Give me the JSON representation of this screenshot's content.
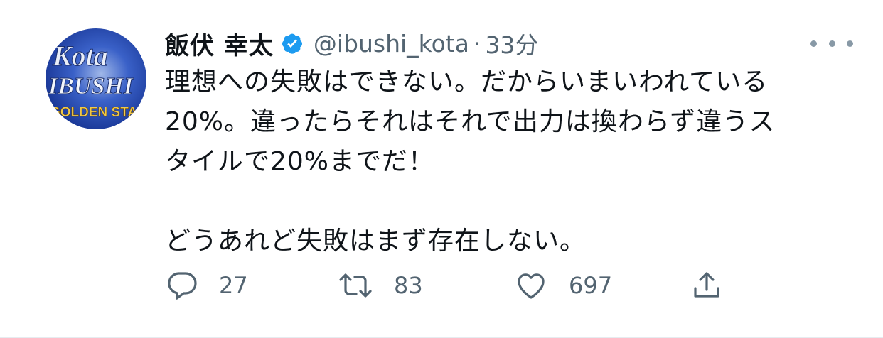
{
  "tweet": {
    "display_name": "飯伏 幸太",
    "verified_icon": "verified-badge-icon",
    "handle": "@ibushi_kota",
    "separator": "·",
    "time": "33分",
    "text": "理想への失敗はできない。だからいまいわれている\n20%。違ったらそれはそれで出力は換わらず違うス\nタイルで20%までだ！\n\nどうあれど失敗はまず存在しない。",
    "avatar_text": {
      "line1": "Kota",
      "line2": "IBUSHI",
      "line3": "GOLDEN STAR"
    },
    "accent_color": "#1d9bf0",
    "actions": {
      "reply_count": "27",
      "retweet_count": "83",
      "like_count": "697"
    }
  }
}
